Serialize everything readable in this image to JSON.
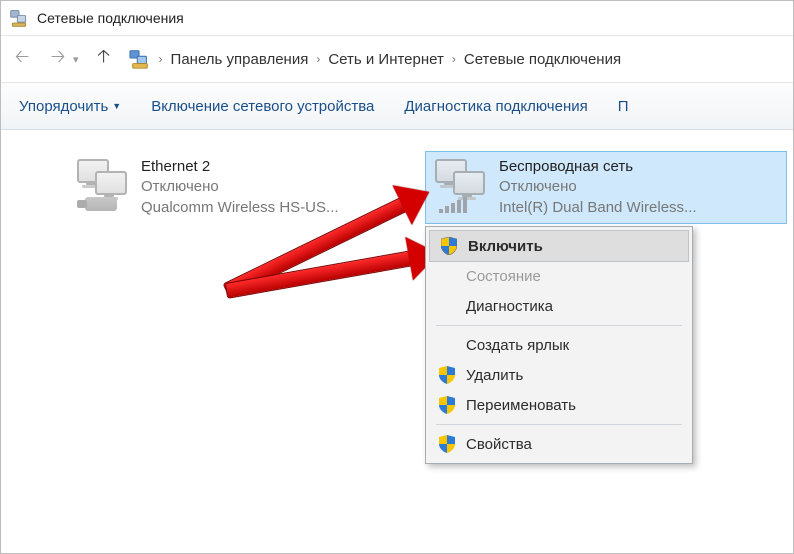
{
  "window": {
    "title": "Сетевые подключения"
  },
  "breadcrumb": {
    "item0": "Панель управления",
    "item1": "Сеть и Интернет",
    "item2": "Сетевые подключения"
  },
  "toolbar": {
    "organize": "Упорядочить",
    "enable_device": "Включение сетевого устройства",
    "diagnose": "Диагностика подключения",
    "overflow": "П"
  },
  "adapters": {
    "ethernet": {
      "name": "Ethernet 2",
      "status": "Отключено",
      "device": "Qualcomm Wireless HS-US..."
    },
    "wifi": {
      "name": "Беспроводная сеть",
      "status": "Отключено",
      "device": "Intel(R) Dual Band Wireless..."
    }
  },
  "context_menu": {
    "enable": "Включить",
    "status": "Состояние",
    "diagnose": "Диагностика",
    "create_shortcut": "Создать ярлык",
    "delete": "Удалить",
    "rename": "Переименовать",
    "properties": "Свойства"
  }
}
